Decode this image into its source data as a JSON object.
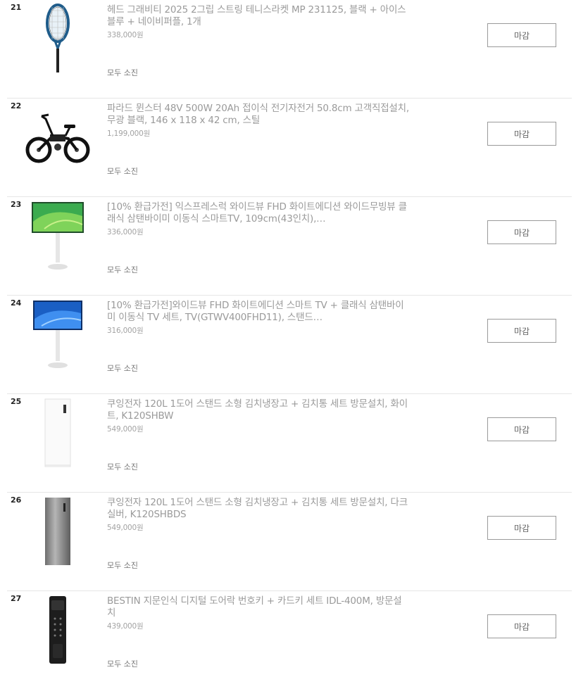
{
  "items": [
    {
      "rank": "21",
      "title": "헤드 그래비티 2025 2그립 스트링 테니스라켓 MP 231125, 블랙 + 아이스블루 + 네이비퍼플, 1개",
      "price": "338,000원",
      "status": "모두 소진",
      "button": "마감",
      "icon": "tennis-racket-icon"
    },
    {
      "rank": "22",
      "title": "파라드 뮌스터 48V 500W 20Ah 접이식 전기자전거 50.8cm 고객직접설치, 무광 블랙, 146 x 118 x 42 cm, 스틸",
      "price": "1,199,000원",
      "status": "모두 소진",
      "button": "마감",
      "icon": "electric-bicycle-icon"
    },
    {
      "rank": "23",
      "title": "[10% 환급가전] 익스프레스럭 와이드뷰 FHD 화이트에디션 와이드무빙뷰 클래식 삼탠바이미 이동식 스마트TV, 109cm(43인치),…",
      "price": "336,000원",
      "status": "모두 소진",
      "button": "마감",
      "icon": "stand-tv-green-icon"
    },
    {
      "rank": "24",
      "title": "[10% 환급가전]와이드뷰 FHD 화이트에디션 스마트 TV + 클래식 삼탠바이미 이동식 TV 세트, TV(GTWV400FHD11), 스탠드…",
      "price": "316,000원",
      "status": "모두 소진",
      "button": "마감",
      "icon": "stand-tv-blue-icon"
    },
    {
      "rank": "25",
      "title": "쿠잉전자 120L 1도어 스탠드 소형 김치냉장고 + 김치통 세트 방문설치, 화이트, K120SHBW",
      "price": "549,000원",
      "status": "모두 소진",
      "button": "마감",
      "icon": "white-refrigerator-icon"
    },
    {
      "rank": "26",
      "title": "쿠잉전자 120L 1도어 스탠드 소형 김치냉장고 + 김치통 세트 방문설치, 다크실버, K120SHBDS",
      "price": "549,000원",
      "status": "모두 소진",
      "button": "마감",
      "icon": "silver-refrigerator-icon"
    },
    {
      "rank": "27",
      "title": "BESTIN 지문인식 디지털 도어락 번호키 + 카드키 세트 IDL-400M, 방문설치",
      "price": "439,000원",
      "status": "모두 소진",
      "button": "마감",
      "icon": "door-lock-icon"
    }
  ]
}
